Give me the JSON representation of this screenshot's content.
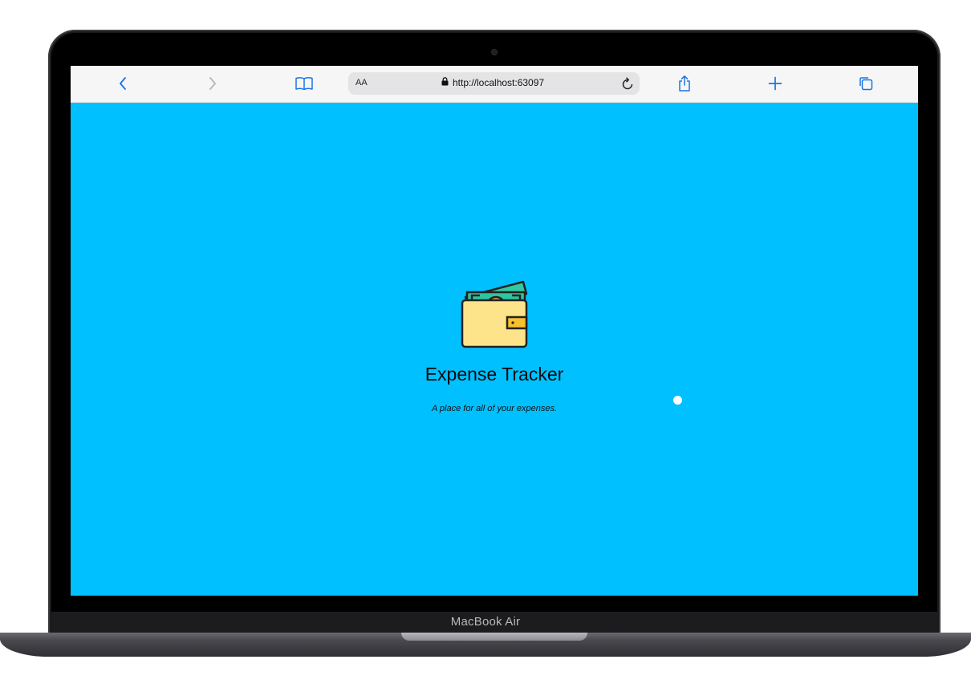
{
  "device": {
    "brand_label": "MacBook Air"
  },
  "browser": {
    "text_size_label": "AA",
    "url": "http://localhost:63097",
    "icons": {
      "back": "chevron-left-icon",
      "forward": "chevron-right-icon",
      "bookmarks": "book-icon",
      "lock": "lock-icon",
      "reload": "reload-icon",
      "share": "share-icon",
      "new_tab": "plus-icon",
      "tabs": "tabs-icon"
    },
    "accent_color": "#1a73e8"
  },
  "page": {
    "background_color": "#00c0ff",
    "logo_icon": "wallet-icon",
    "title": "Expense Tracker",
    "subtitle": "A place for all of your expenses."
  }
}
